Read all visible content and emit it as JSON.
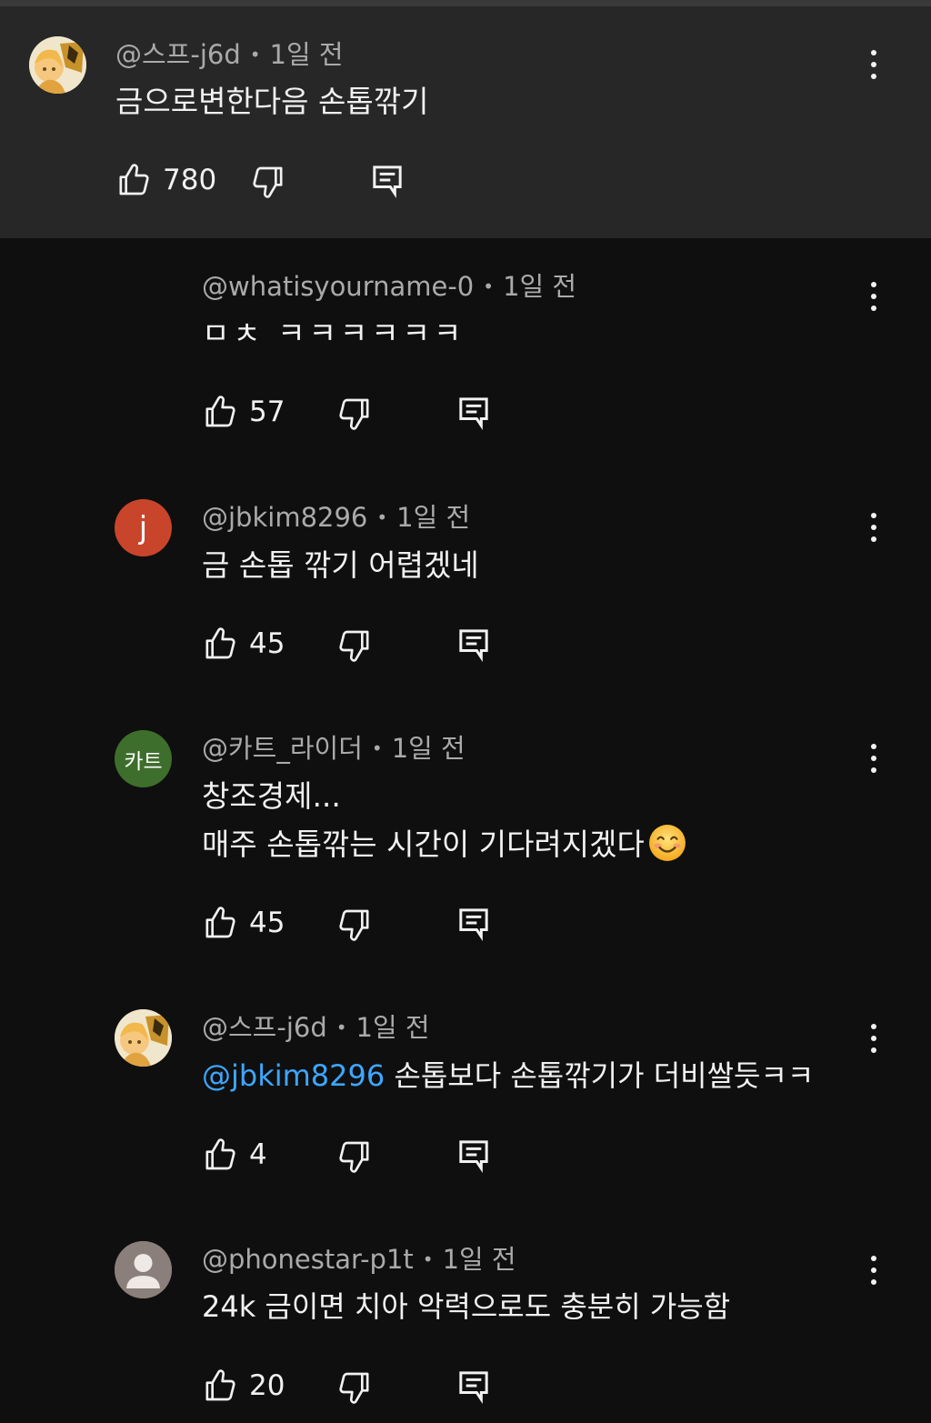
{
  "comments": [
    {
      "author": "@스프-j6d",
      "time": "1일 전",
      "text_lines": [
        "금으로변한다음 손톱깎기"
      ],
      "likes": "780",
      "avatar": {
        "type": "illustration",
        "bg": "#d9b25c"
      }
    },
    {
      "author": "@whatisyourname-0",
      "time": "1일 전",
      "text_lines": [
        "ㅁㅊ ㅋㅋㅋㅋㅋㅋ"
      ],
      "likes": "57"
    },
    {
      "author": "@jbkim8296",
      "time": "1일 전",
      "text_lines": [
        "금 손톱 깎기 어렵겠네"
      ],
      "likes": "45",
      "avatar": {
        "type": "letter",
        "letter": "j",
        "bg": "#c8452b"
      }
    },
    {
      "author": "@카트_라이더",
      "time": "1일 전",
      "text_lines": [
        "창조경제...",
        "매주 손톱깎는 시간이 기다려지겠다"
      ],
      "likes": "45",
      "avatar": {
        "type": "letter",
        "letter": "카트",
        "bg": "#3e6e2b"
      },
      "emoji": "smiling-face"
    },
    {
      "author": "@스프-j6d",
      "time": "1일 전",
      "mention": "@jbkim8296",
      "text_lines": [
        " 손톱보다 손톱깎기가 더비쌀듯ㅋㅋ"
      ],
      "likes": "4",
      "avatar": {
        "type": "illustration",
        "bg": "#d9b25c"
      }
    },
    {
      "author": "@phonestar-p1t",
      "time": "1일 전",
      "text_lines": [
        "24k 금이면 치아 악력으로도 충분히 가능함"
      ],
      "likes": "20",
      "avatar": {
        "type": "default-person",
        "bg": "#8a7f7a"
      }
    }
  ],
  "separator": "•",
  "colors": {
    "page_bg": "#0f0f0f",
    "highlight_bg": "#272727",
    "meta_text": "#aaaaaa",
    "text": "#f1f1f1",
    "mention": "#3ea6ff"
  },
  "icons": {
    "like": "thumbs-up-icon",
    "dislike": "thumbs-down-icon",
    "reply": "reply-comment-icon",
    "more": "more-vertical-icon"
  }
}
